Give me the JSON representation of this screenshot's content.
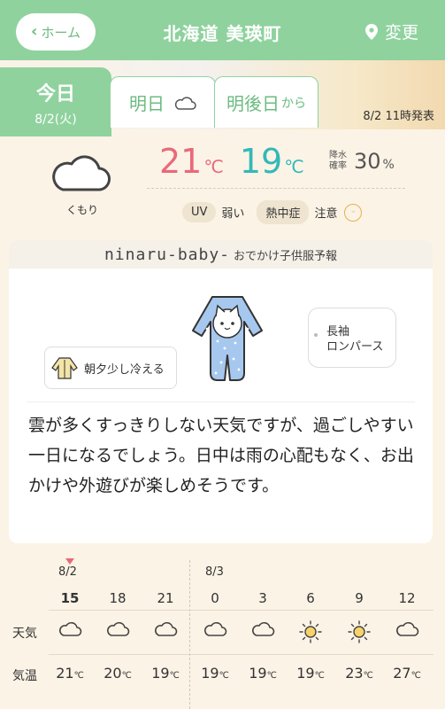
{
  "header": {
    "home_label": "ホーム",
    "location": "北海道 美瑛町",
    "change_label": "変更"
  },
  "tabs": {
    "today_label": "今日",
    "today_date": "8/2(火)",
    "tomorrow_label": "明日",
    "after_label": "明後日",
    "after_suffix": "から",
    "published": "8/2  11時発表"
  },
  "today": {
    "weather": "くもり",
    "high": "21",
    "low": "19",
    "unit": "℃",
    "precip_label_1": "降水",
    "precip_label_2": "確率",
    "precip_value": "30",
    "precip_unit": "%",
    "uv_label": "UV",
    "uv_value": "弱い",
    "heat_label": "熱中症",
    "heat_value": "注意"
  },
  "kids": {
    "brand": "ninaru-baby-",
    "subtitle": "おでかけ子供服予報",
    "outfit_line1": "長袖",
    "outfit_line2": "ロンパース",
    "extra": "朝夕少し冷える",
    "description": "雲が多くすっきりしない天気ですが、過ごしやすい一日になるでしょう。日中は雨の心配もなく、お出かけや外遊びが楽しめそうです。"
  },
  "hourly": {
    "date1": "8/2",
    "date2": "8/3",
    "weather_label": "天気",
    "temp_label": "気温",
    "unit": "℃",
    "hours": [
      "15",
      "18",
      "21",
      "0",
      "3",
      "6",
      "9",
      "12"
    ],
    "temps": [
      "21",
      "20",
      "19",
      "19",
      "19",
      "19",
      "23",
      "27"
    ],
    "icons": [
      "cloud-icon",
      "cloud-icon",
      "cloud-icon",
      "cloud-icon",
      "cloud-icon",
      "sun-icon",
      "sun-icon",
      "cloud-icon"
    ]
  },
  "colors": {
    "accent": "#8fd29e",
    "high": "#e9697a",
    "low": "#33b9b7"
  }
}
